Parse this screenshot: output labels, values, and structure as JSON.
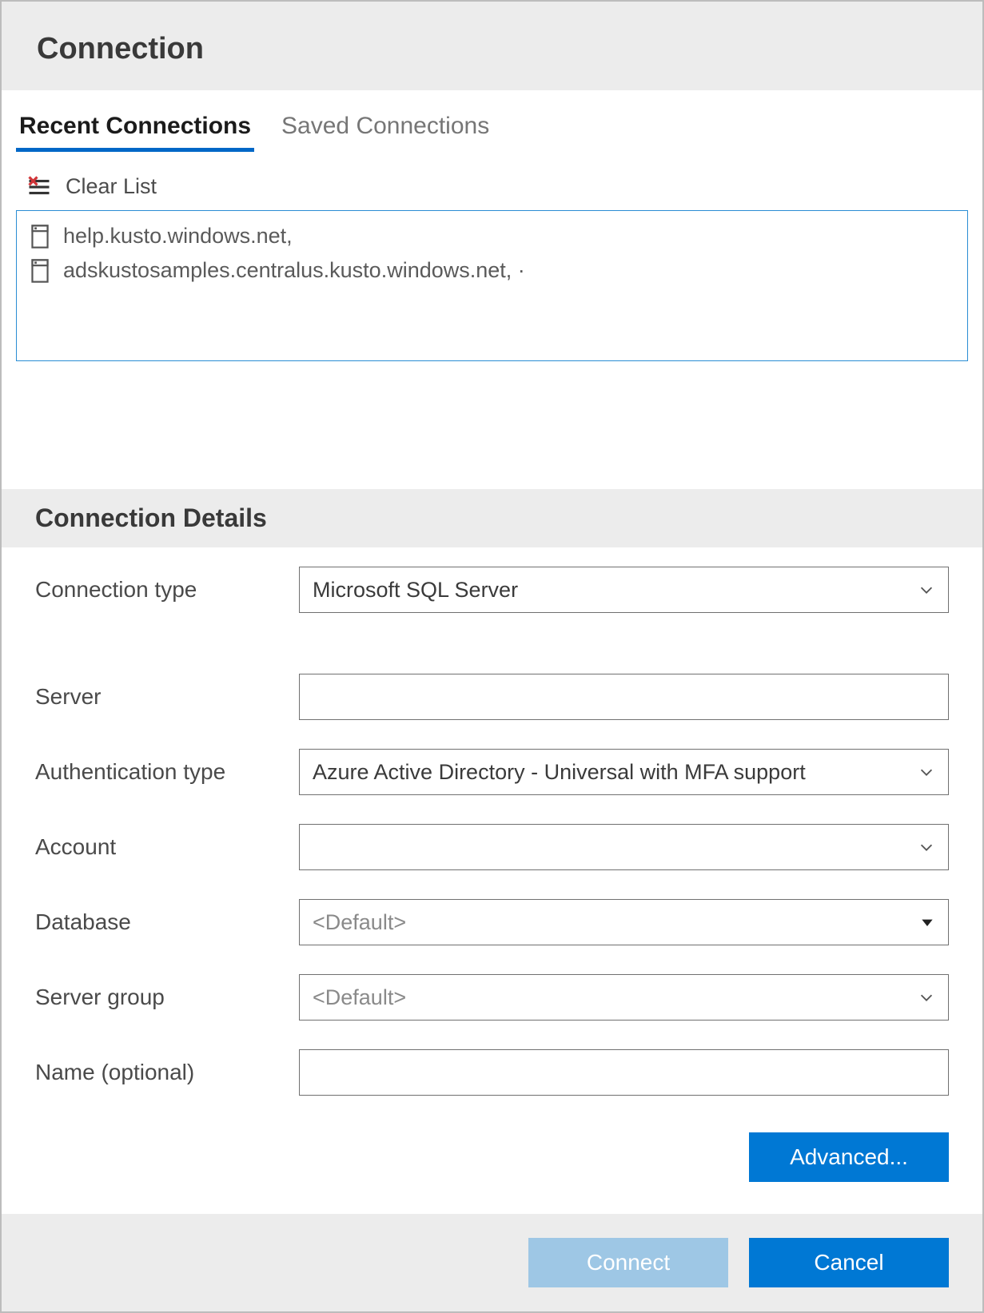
{
  "header": {
    "title": "Connection"
  },
  "tabs": {
    "recent": "Recent Connections",
    "saved": "Saved Connections",
    "active": "recent"
  },
  "toolbar": {
    "clear_label": "Clear List"
  },
  "recent_connections": [
    {
      "label": "help.kusto.windows.net,"
    },
    {
      "label": "adskustosamples.centralus.kusto.windows.net,  ·"
    }
  ],
  "details": {
    "heading": "Connection Details",
    "labels": {
      "connection_type": "Connection type",
      "server": "Server",
      "auth_type": "Authentication type",
      "account": "Account",
      "database": "Database",
      "server_group": "Server group",
      "name": "Name (optional)"
    },
    "values": {
      "connection_type": "Microsoft SQL Server",
      "server": "",
      "auth_type": "Azure Active Directory - Universal with MFA support",
      "account": "",
      "database": "<Default>",
      "server_group": "<Default>",
      "name": ""
    }
  },
  "buttons": {
    "advanced": "Advanced...",
    "connect": "Connect",
    "cancel": "Cancel"
  }
}
